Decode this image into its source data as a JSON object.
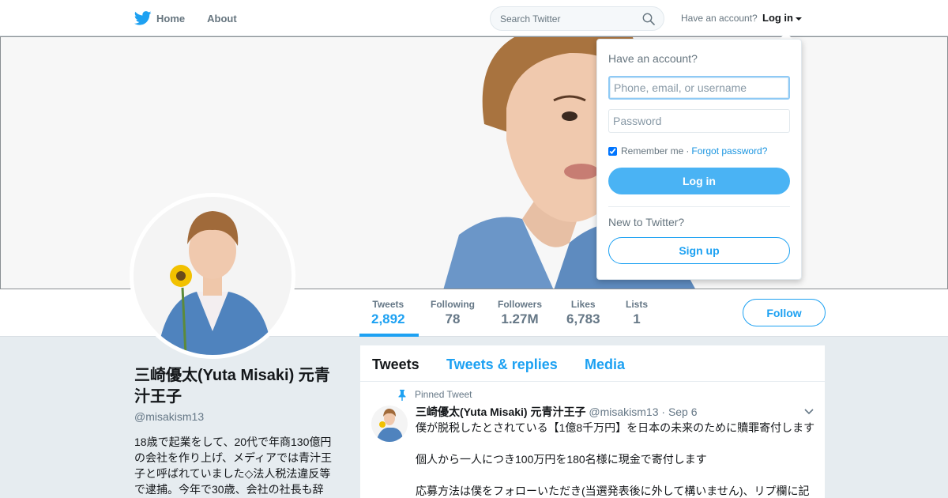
{
  "nav": {
    "home_label": "Home",
    "about_label": "About",
    "search_placeholder": "Search Twitter",
    "have_account": "Have an account?",
    "login_label": "Log in"
  },
  "profile": {
    "name": "三崎優太(Yuta Misaki) 元青汁王子",
    "handle": "@misakism13",
    "bio": "18歳で起業をして、20代で年商130億円の会社を作り上げ、メディアでは青汁王子と呼ばれていました◇法人税法違反等で逮捕。今年で30歳、会社の社長も辞"
  },
  "stats": [
    {
      "label": "Tweets",
      "value": "2,892"
    },
    {
      "label": "Following",
      "value": "78"
    },
    {
      "label": "Followers",
      "value": "1.27M"
    },
    {
      "label": "Likes",
      "value": "6,783"
    },
    {
      "label": "Lists",
      "value": "1"
    }
  ],
  "follow_label": "Follow",
  "timeline": {
    "tabs": [
      "Tweets",
      "Tweets & replies",
      "Media"
    ],
    "pinned_label": "Pinned Tweet",
    "tweet": {
      "name": "三崎優太(Yuta Misaki) 元青汁王子",
      "handle": "@misakism13",
      "dot": "·",
      "date": "Sep 6",
      "lines": [
        "僕が脱税したとされている【1億8千万円】を日本の未来のために贖罪寄付します",
        "個人から一人につき100万円を180名様に現金で寄付します",
        "応募方法は僕をフォローいただき(当選発表後に外して構いません)、リプ欄に記"
      ]
    }
  },
  "login_dropdown": {
    "title": "Have an account?",
    "username_placeholder": "Phone, email, or username",
    "password_placeholder": "Password",
    "remember_label": "Remember me",
    "separator": "·",
    "forgot_label": "Forgot password?",
    "login_button": "Log in",
    "new_label": "New to Twitter?",
    "signup_button": "Sign up"
  },
  "colors": {
    "accent": "#1da1f2",
    "login_button": "#4ab3f4",
    "background": "#e6ecf0"
  }
}
